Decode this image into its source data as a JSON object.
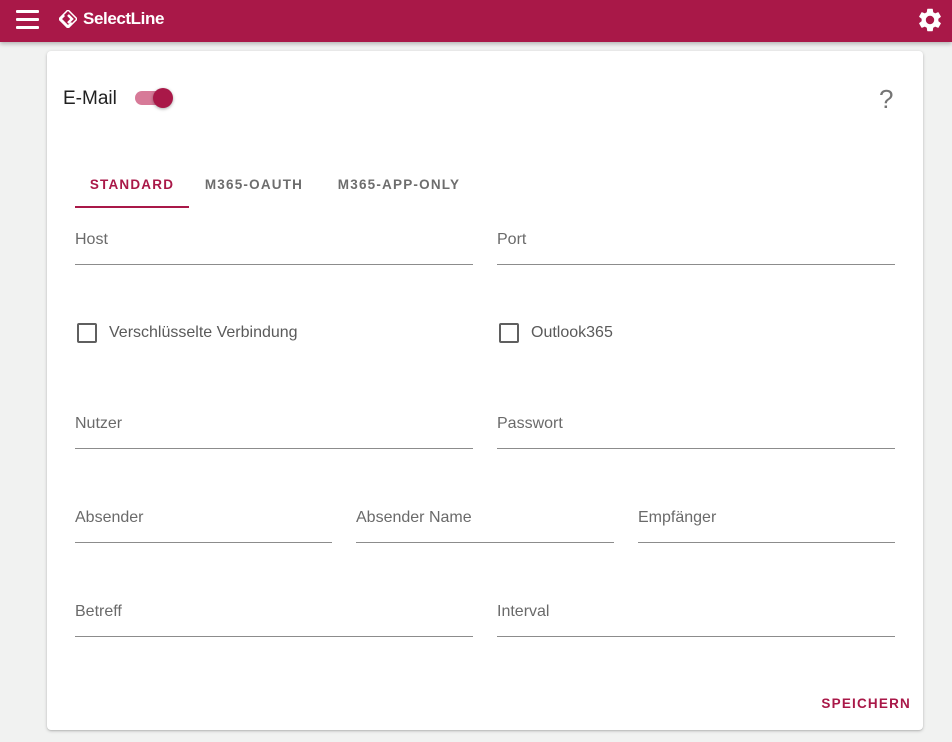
{
  "app": {
    "brand": "SelectLine",
    "brand_color": "#a91848"
  },
  "header": {
    "menu_icon": "hamburger-icon",
    "settings_icon": "gear-icon"
  },
  "card": {
    "title": "E-Mail",
    "enabled": true,
    "help_label": "?"
  },
  "tabs": [
    {
      "label": "STANDARD",
      "active": true
    },
    {
      "label": "M365-OAUTH",
      "active": false
    },
    {
      "label": "M365-APP-ONLY",
      "active": false
    }
  ],
  "fields": {
    "host": {
      "label": "Host",
      "value": ""
    },
    "port": {
      "label": "Port",
      "value": ""
    },
    "nutzer": {
      "label": "Nutzer",
      "value": ""
    },
    "passwort": {
      "label": "Passwort",
      "value": ""
    },
    "absender": {
      "label": "Absender",
      "value": ""
    },
    "absender_name": {
      "label": "Absender Name",
      "value": ""
    },
    "empfaenger": {
      "label": "Empfänger",
      "value": ""
    },
    "betreff": {
      "label": "Betreff",
      "value": ""
    },
    "interval": {
      "label": "Interval",
      "value": ""
    }
  },
  "checkboxes": {
    "encrypted": {
      "label": "Verschlüsselte Verbindung",
      "checked": false
    },
    "outlook365": {
      "label": "Outlook365",
      "checked": false
    }
  },
  "actions": {
    "save_label": "SPEICHERN"
  }
}
